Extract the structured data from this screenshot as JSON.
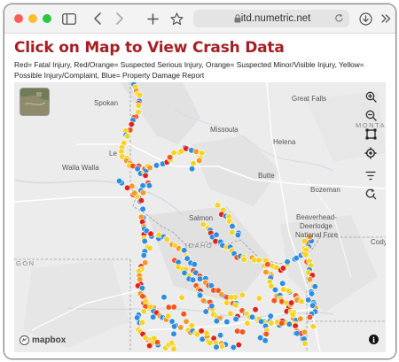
{
  "browser": {
    "url": "itd.numetric.net",
    "buttons": [
      "sidebar-toggle",
      "back",
      "forward",
      "new-tab",
      "bookmark",
      "reload",
      "downloads",
      "more"
    ]
  },
  "page": {
    "title": "Click on Map to View Crash Data",
    "legend": "Red= Fatal Injury, Red/Orange= Suspected Serious Injury, Orange= Suspected Minor/Visible Injury, Yellow= Possible Injury/Complaint, Blue= Property Damage Report"
  },
  "colors": {
    "fatal": "#e0231c",
    "serious": "#f2551e",
    "minor": "#f39a21",
    "possible": "#f6d322",
    "property": "#2d8de0",
    "title": "#a51f22"
  },
  "map": {
    "labels": {
      "spokane": "Spokan",
      "missoula": "Missoula",
      "great_falls": "Great Falls",
      "helena": "Helena",
      "montana": "MONTA",
      "walla_walla": "Walla Walla",
      "butte": "Butte",
      "bozeman": "Bozeman",
      "salmon": "Salmon",
      "idaho": "IDAHO",
      "beaverhead": "Beaverhead-",
      "deerlodge": "Deerlodge",
      "national_forest": "National Fore",
      "cody": "Cody",
      "oregon": "GON",
      "le": "Le"
    },
    "attribution": "mapbox",
    "controls": [
      "zoom-in",
      "zoom-out",
      "box-select",
      "locate",
      "filter",
      "reset-view"
    ],
    "info_label": "i"
  }
}
